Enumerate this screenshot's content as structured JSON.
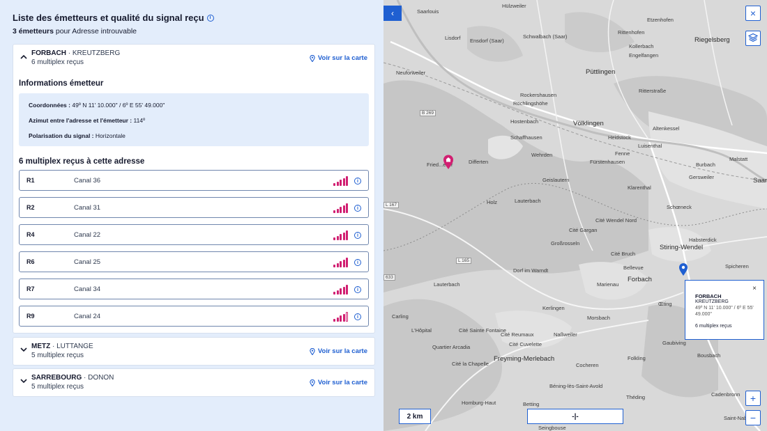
{
  "header": {
    "title": "Liste des émetteurs et qualité du signal reçu",
    "count_bold": "3 émetteurs",
    "count_rest": " pour Adresse introuvable"
  },
  "transmitters": [
    {
      "name": "FORBACH",
      "site": " · KREUTZBERG",
      "mux_count": "6 multiplex reçus",
      "see_map": "Voir sur la carte",
      "expanded": true
    },
    {
      "name": "METZ",
      "site": " · LUTTANGE",
      "mux_count": "5 multiplex reçus",
      "see_map": "Voir sur la carte",
      "expanded": false
    },
    {
      "name": "SARREBOURG",
      "site": " · DONON",
      "mux_count": "5 multiplex reçus",
      "see_map": "Voir sur la carte",
      "expanded": false
    }
  ],
  "details": {
    "info_title": "Informations émetteur",
    "coords_label": "Coordonnées :",
    "coords_value": " 49º N 11' 10.000\" / 6º E 55' 49.000\"",
    "azimuth_label": "Azimut entre l'adresse et l'émetteur :",
    "azimuth_value": " 114º",
    "polar_label": "Polarisation du signal :",
    "polar_value": " Horizontale",
    "mux_title": "6 multiplex reçus à cette adresse",
    "multiplexes": [
      {
        "id": "R1",
        "channel": "Canal 36",
        "signal": 5
      },
      {
        "id": "R2",
        "channel": "Canal 31",
        "signal": 5
      },
      {
        "id": "R4",
        "channel": "Canal 22",
        "signal": 5
      },
      {
        "id": "R6",
        "channel": "Canal 25",
        "signal": 5
      },
      {
        "id": "R7",
        "channel": "Canal 34",
        "signal": 5
      },
      {
        "id": "R9",
        "channel": "Canal 24",
        "signal": 4
      }
    ]
  },
  "map": {
    "scale": "2 km",
    "cursor": "-|-",
    "labels": {
      "l1": "Saarlouis",
      "l2": "Hülzweiler",
      "l3": "Etzenhofen",
      "l4": "Rittenhofen",
      "l5": "Riegelsberg",
      "l6": "Lisdorf",
      "l7": "Ensdorf (Saar)",
      "l8": "Schwalbach (Saar)",
      "l9": "Kollerbach",
      "l10": "Engelfangen",
      "l11": "Neuforweiler",
      "l12": "Püttlingen",
      "l13": "Ritterstraße",
      "l14": "Rockershausen",
      "l15": "Röchlingshöhe",
      "l16": "Hostenbach",
      "l17": "Schaffhausen",
      "l18": "Völklingen",
      "l19": "Heidstock",
      "l20": "Altenkessel",
      "l21": "Luisenthal",
      "l22": "Malstatt",
      "l23": "Wehrden",
      "l24": "Fürstenhausen",
      "l25": "Fenne",
      "l26": "Burbach",
      "l27": "Differten",
      "l28": "Geislautern",
      "l29": "Klarenthal",
      "l30": "Gersweiler",
      "l31": "Lauterbach",
      "l32": "Schœneck",
      "l33": "Cité Gargan",
      "l34": "Cité Wendel Nord",
      "l35": "Großrosseln",
      "l36": "Stiring-Wendel",
      "l37": "Habsterdick",
      "l38": "Cité Bruch",
      "l39": "Bellevue",
      "l40": "Spicheren",
      "l41": "Dorf im Warndt",
      "l42": "Forbach",
      "l43": "Marienau",
      "l44": "Œting",
      "l45": "Carling",
      "l46": "Morsbach",
      "l47": "L'Hôpital",
      "l48": "Cité Sainte Fontaine",
      "l49": "Cité Reumaux",
      "l50": "Naßweiler",
      "l51": "Cité Cuvelette",
      "l52": "Quartier Arcadia",
      "l53": "Freyming-Merlebach",
      "l54": "Folkling",
      "l55": "Gaubiving",
      "l56": "Bousbach",
      "l57": "Cité la Chapelle",
      "l58": "Cocheren",
      "l59": "Béning-lès-Saint-Avold",
      "l60": "Théding",
      "l61": "Homburg-Haut",
      "l62": "Betting",
      "l63": "Seingbouse",
      "l64": "Cadenbronn",
      "l65": "Saint-Nab.",
      "l66": "Fried...eiler",
      "l67": "Saar",
      "l68": "Holz",
      "l69": "Kerlingen"
    },
    "roads": {
      "r1": "B 269",
      "r2": "L 167",
      "r3": "L 165",
      "r4": "633"
    },
    "popup": {
      "name": "FORBACH",
      "site": "KREUTZBERG",
      "coords": "49º N 11' 10.000\" / 6º E 55' 49.000\"",
      "mux": "6 multiplex reçus",
      "close": "×"
    },
    "controls": {
      "close": "×",
      "zoom_in": "+",
      "zoom_out": "−",
      "back": "‹"
    }
  },
  "colors": {
    "accent": "#1f5fd1",
    "signal": "#d11f71",
    "panel_bg": "#e3edfb"
  }
}
